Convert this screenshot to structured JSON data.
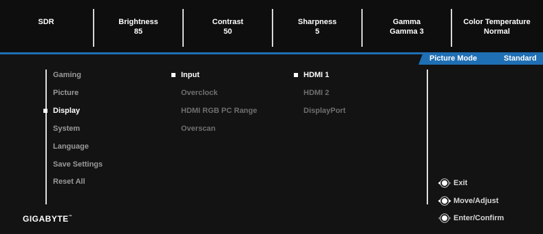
{
  "top_bar": [
    {
      "label": "SDR",
      "value": ""
    },
    {
      "label": "Brightness",
      "value": "85"
    },
    {
      "label": "Contrast",
      "value": "50"
    },
    {
      "label": "Sharpness",
      "value": "5"
    },
    {
      "label": "Gamma",
      "value": "Gamma 3"
    },
    {
      "label": "Color Temperature",
      "value": "Normal"
    }
  ],
  "mode_tab": {
    "label": "Picture Mode",
    "value": "Standard"
  },
  "main_menu": [
    {
      "label": "Gaming",
      "selected": false
    },
    {
      "label": "Picture",
      "selected": false
    },
    {
      "label": "Display",
      "selected": true
    },
    {
      "label": "System",
      "selected": false
    },
    {
      "label": "Language",
      "selected": false
    },
    {
      "label": "Save Settings",
      "selected": false
    },
    {
      "label": "Reset All",
      "selected": false
    }
  ],
  "sub_menu": [
    {
      "label": "Input",
      "selected": true
    },
    {
      "label": "Overclock",
      "selected": false
    },
    {
      "label": "HDMI RGB PC Range",
      "selected": false
    },
    {
      "label": "Overscan",
      "selected": false
    }
  ],
  "options": [
    {
      "label": "HDMI 1",
      "selected": true
    },
    {
      "label": "HDMI 2",
      "selected": false
    },
    {
      "label": "DisplayPort",
      "selected": false
    }
  ],
  "hints": [
    {
      "label": "Exit",
      "icon": "joystick-left-icon"
    },
    {
      "label": "Move/Adjust",
      "icon": "joystick-updown-icon"
    },
    {
      "label": "Enter/Confirm",
      "icon": "joystick-press-icon"
    }
  ],
  "brand": {
    "name": "GIGABYTE",
    "mark": "™"
  },
  "colors": {
    "accent": "#1f6fb4",
    "background": "#131313"
  }
}
